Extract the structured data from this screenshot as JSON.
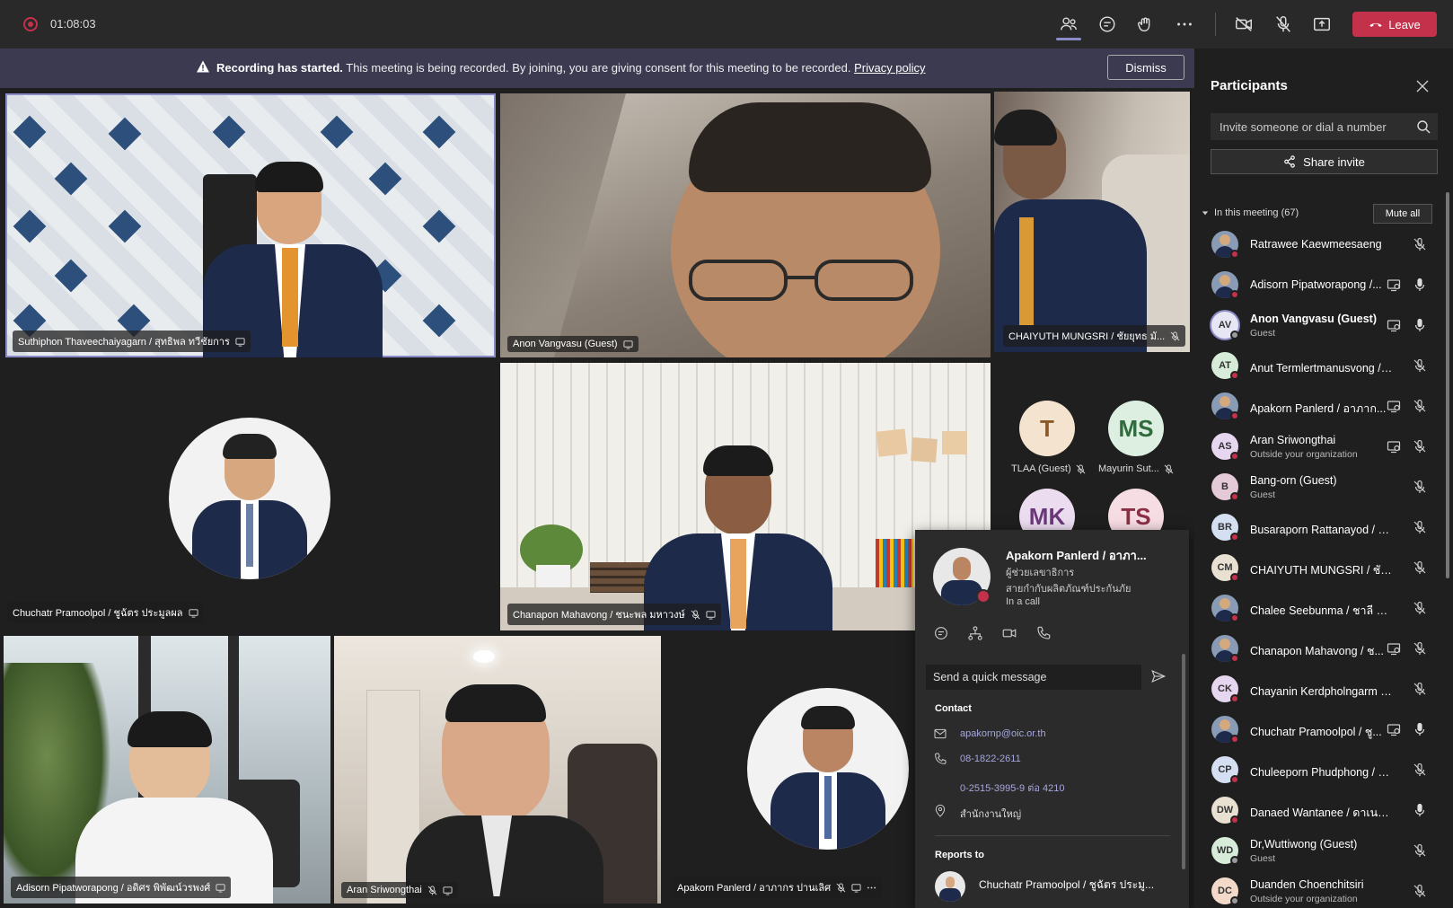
{
  "topbar": {
    "timer": "01:08:03",
    "leave_label": "Leave"
  },
  "banner": {
    "title": "Recording has started.",
    "message": " This meeting is being recorded. By joining, you are giving consent for this meeting to be recorded. ",
    "link": "Privacy policy",
    "dismiss_label": "Dismiss"
  },
  "tiles": {
    "t1": "Suthiphon Thaveechaiyagarn / สุทธิพล ทวีชัยการ",
    "t2": "Anon Vangvasu (Guest)",
    "t3": "CHAIYUTH MUNGSRI / ชัยยุทธ มั...",
    "t4": "Chuchatr Pramoolpol / ชูฉัตร ประมูลผล",
    "t5": "Chanapon Mahavong / ชนะพล มหาวงษ์",
    "t6": "Adisorn Pipatworapong / อดิศร พิพัฒน์วรพงศ์",
    "t7": "Aran Sriwongthai",
    "t8": "Apakorn Panlerd / อาภากร ปานเลิศ"
  },
  "initials": [
    {
      "letters": "T",
      "label": "TLAA (Guest)",
      "bg": "#f4e4cf",
      "fg": "#8a5a2b"
    },
    {
      "letters": "MS",
      "label": "Mayurin Sut...",
      "bg": "#dcefe1",
      "fg": "#2f6b3d"
    },
    {
      "letters": "MK",
      "label": "",
      "bg": "#ecdcf0",
      "fg": "#6a3a78"
    },
    {
      "letters": "TS",
      "label": "",
      "bg": "#f6dce3",
      "fg": "#8a2f45"
    }
  ],
  "card": {
    "name": "Apakorn Panlerd / อาภา...",
    "role": "ผู้ช่วยเลขาธิการ",
    "dept": "สายกำกับผลิตภัณฑ์ประกันภัย",
    "status": "In a call",
    "quick_placeholder": "Send a quick message",
    "contact_heading": "Contact",
    "email": "apakornp@oic.or.th",
    "mobile": "08-1822-2611",
    "phone": "0-2515-3995-9 ต่อ 4210",
    "office": "สำนักงานใหญ่",
    "reports_heading": "Reports to",
    "manager": "Chuchatr Pramoolpol / ชูฉัตร ประมู..."
  },
  "panel": {
    "title": "Participants",
    "invite_placeholder": "Invite someone or dial a number",
    "share_label": "Share invite",
    "in_meeting": "In this meeting (67)",
    "mute_all": "Mute all",
    "participants": [
      {
        "name": "Ratrawee Kaewmeesaeng",
        "sub": "",
        "initials": "",
        "photo": true,
        "share": false,
        "mic": "muted"
      },
      {
        "name": "Adisorn Pipatworapong /...",
        "sub": "",
        "initials": "",
        "photo": true,
        "share": true,
        "mic": "on"
      },
      {
        "name": "Anon Vangvasu (Guest)",
        "sub": "Guest",
        "initials": "AV",
        "photo": false,
        "share": true,
        "mic": "on"
      },
      {
        "name": "Anut Termlertmanusvong / อ...",
        "sub": "",
        "initials": "AT",
        "photo": false,
        "share": false,
        "mic": "muted"
      },
      {
        "name": "Apakorn Panlerd / อาภาก...",
        "sub": "",
        "initials": "",
        "photo": true,
        "share": true,
        "mic": "muted"
      },
      {
        "name": "Aran Sriwongthai",
        "sub": "Outside your organization",
        "initials": "AS",
        "photo": false,
        "share": true,
        "mic": "muted"
      },
      {
        "name": "Bang-orn (Guest)",
        "sub": "Guest",
        "initials": "B",
        "photo": false,
        "share": false,
        "mic": "muted"
      },
      {
        "name": "Busaraporn Rattanayod / บุษร...",
        "sub": "",
        "initials": "BR",
        "photo": false,
        "share": false,
        "mic": "muted"
      },
      {
        "name": "CHAIYUTH MUNGSRI / ชัยยุท...",
        "sub": "",
        "initials": "CM",
        "photo": false,
        "share": false,
        "mic": "muted"
      },
      {
        "name": "Chalee Seebunma / ชาลี ศรีบุ...",
        "sub": "",
        "initials": "",
        "photo": true,
        "share": false,
        "mic": "muted"
      },
      {
        "name": "Chanapon Mahavong / ช...",
        "sub": "",
        "initials": "",
        "photo": true,
        "share": true,
        "mic": "muted"
      },
      {
        "name": "Chayanin Kerdpholngarm / ช...",
        "sub": "",
        "initials": "CK",
        "photo": false,
        "share": false,
        "mic": "muted"
      },
      {
        "name": "Chuchatr Pramoolpol / ชู...",
        "sub": "",
        "initials": "",
        "photo": true,
        "share": true,
        "mic": "on"
      },
      {
        "name": "Chuleeporn Phudphong / ชูลี...",
        "sub": "",
        "initials": "CP",
        "photo": false,
        "share": false,
        "mic": "muted"
      },
      {
        "name": "Danaed Wantanee / ดาเนตร วั...",
        "sub": "",
        "initials": "DW",
        "photo": false,
        "share": false,
        "mic": "on"
      },
      {
        "name": "Dr,Wuttiwong (Guest)",
        "sub": "Guest",
        "initials": "WD",
        "photo": false,
        "share": false,
        "mic": "muted"
      },
      {
        "name": "Duanden Choenchitsiri",
        "sub": "Outside your organization",
        "initials": "DC",
        "photo": false,
        "share": false,
        "mic": "muted"
      }
    ]
  },
  "colors": {
    "accent": "#8b8cc7",
    "leave": "#c4314b",
    "link": "#a6a7dc"
  }
}
